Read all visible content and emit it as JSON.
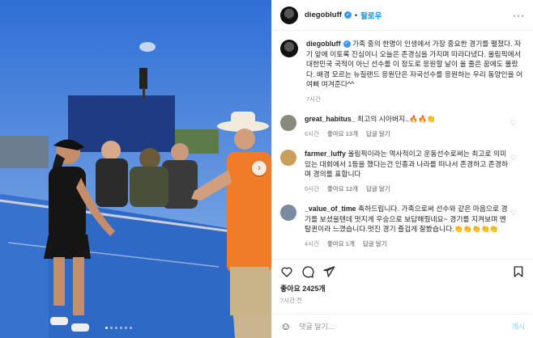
{
  "post": {
    "username": "diegobluff",
    "follow_label": "팔로우",
    "more_label": "···",
    "caption": "가족 중의 한명이 인생에서 가장 중요한 경기를 펼쳤다. 자기 앞에 이토록 진심이니 오늘은 존경심을 가지며 따라다녔다. 올림픽에서 대한민국 국적이 아닌 선수를 이 정도로 응원할 날이 올 줄은 꿈에도 몰랐다. 배경 모르는 뉴질랜드 응원단은 자국선수를 응원하는 우리 동양인을 어여삐 여겨준다^^",
    "caption_time": "7시간",
    "likes_label": "좋아요 2425개",
    "time_ago": "7시간 전",
    "comment_placeholder": "댓글 달기...",
    "post_button": "게시"
  },
  "comments": [
    {
      "username": "great_habitus_",
      "text": "최고의 시아버지..🔥🔥👏",
      "time": "6시간",
      "likes": "좋아요 13개",
      "reply": "답글 달기",
      "avatar_color": "#8a8a7a"
    },
    {
      "username": "farmer_luffy",
      "text": "올림픽이라는 역사적이고 운동선수로써는 최고로 의미있는 대회에서 1등을 했다는건 인종과 나라를 떠나서 존경하고 존경하며 경의를 표합니다",
      "time": "6시간",
      "likes": "좋아요 12개",
      "reply": "답글 달기",
      "avatar_color": "#c9a05a"
    },
    {
      "username": "_value_of_time",
      "text": "축하드립니다. 가족으로써 선수와 같은 마음으로 경기를 보셨을텐데 멋지게 우승으로 보답해줬네요~ 경기를 지켜보며 멘탈퀸이라 느꼈습니다.멋진 경기 즐겁게 잘봤습니다.👏👏👏👏👏",
      "time": "4시간",
      "likes": "좋아요 1개",
      "reply": "답글 달기",
      "avatar_color": "#7a8aa0"
    }
  ],
  "carousel": {
    "slides": 6,
    "active_index": 0
  },
  "icons": {
    "heart": "heart-icon",
    "comment": "comment-icon",
    "share": "share-icon",
    "save": "bookmark-icon",
    "emoji": "emoji-icon",
    "verified": "verified-badge-icon",
    "next": "chevron-right-icon"
  },
  "colors": {
    "accent": "#0095f6",
    "verified": "#3897f0",
    "muted": "#8e8e8e"
  }
}
